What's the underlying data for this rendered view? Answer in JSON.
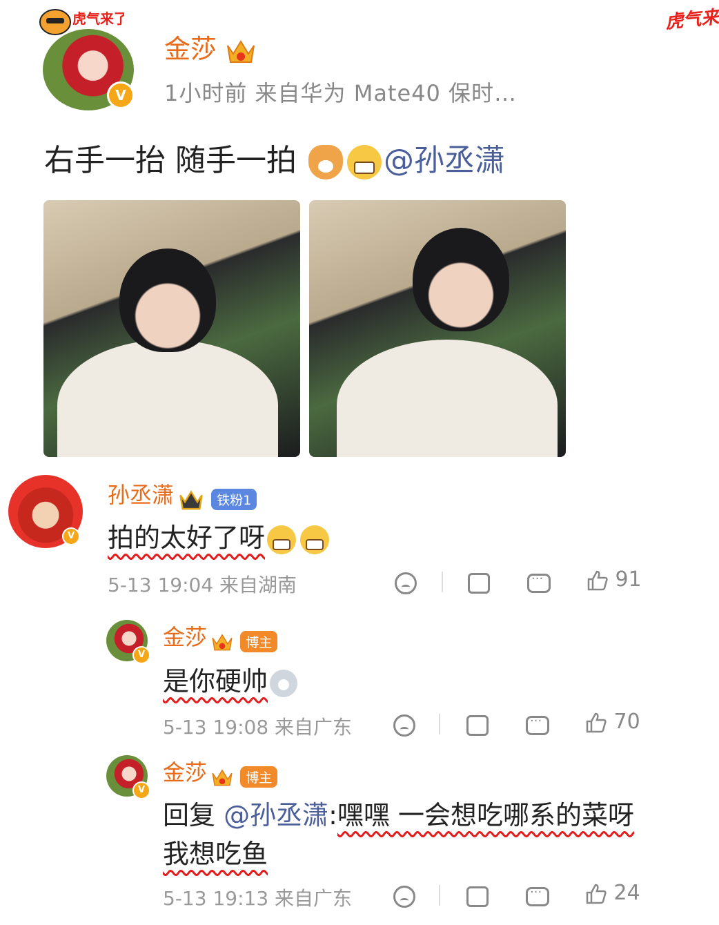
{
  "post": {
    "author": "金莎",
    "meta": "1小时前  来自华为 Mate40 保时…",
    "corner_tag": "虎气来",
    "avatar_tag": "虎气来了",
    "text_main": "右手一抬 随手一拍 ",
    "mention": "@孙丞潇"
  },
  "comments": [
    {
      "author": "孙丞潇",
      "badge": "铁粉1",
      "text": "拍的太好了呀",
      "meta": "5-13 19:04  来自湖南",
      "likes": "91"
    },
    {
      "author": "金莎",
      "badge": "博主",
      "text": "是你硬帅",
      "meta": "5-13 19:08  来自广东",
      "likes": "70"
    },
    {
      "author": "金莎",
      "badge": "博主",
      "reply_prefix": "回复",
      "reply_mention": "@孙丞潇",
      "colon": ":",
      "text_line1": "嘿嘿 一会想吃哪系的菜呀",
      "text_line2": "我想吃鱼",
      "meta": "5-13 19:13  来自广东",
      "likes": "24"
    }
  ],
  "icons": {
    "dislike": "sad-face-icon",
    "repost": "repost-icon",
    "comment": "comment-icon",
    "like": "thumbs-up-icon"
  }
}
